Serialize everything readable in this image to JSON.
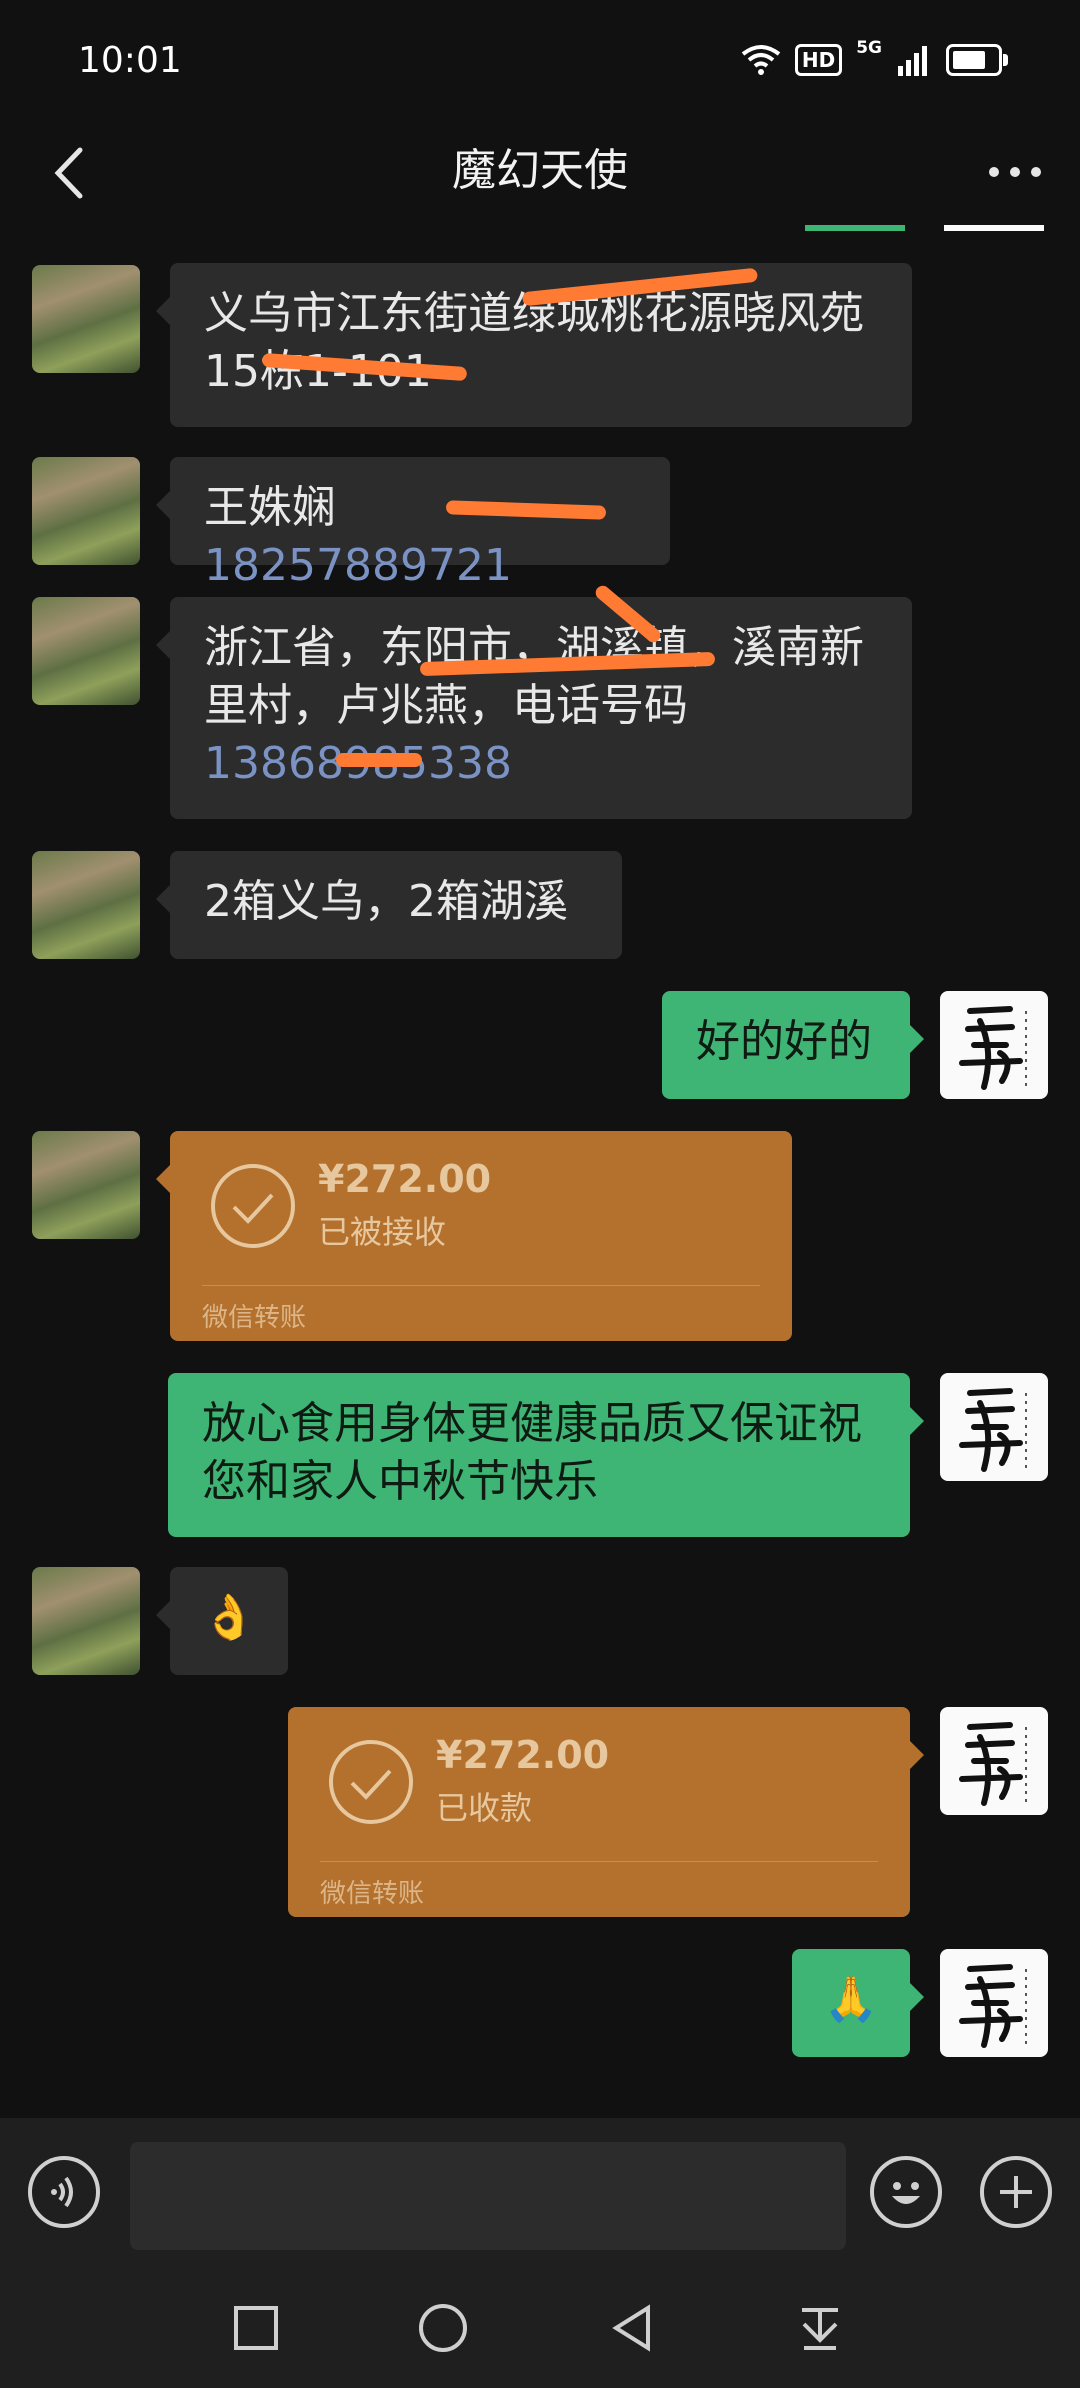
{
  "status_bar": {
    "time": "10:01",
    "hd": "HD",
    "network": "5G"
  },
  "header": {
    "title": "魔幻天使"
  },
  "messages": [
    {
      "side": "left",
      "text": "义乌市江东街道绿城桃花源晓风苑15栋1-101"
    },
    {
      "side": "left",
      "prefix": "王姝娴 ",
      "phone": "18257889721"
    },
    {
      "side": "left",
      "text": "浙江省，东阳市，湖溪镇，溪南新里村，卢兆燕，电话号码",
      "phone": "13868985338"
    },
    {
      "side": "left",
      "text": "2箱义乌，2箱湖溪"
    },
    {
      "side": "right",
      "text": "好的好的"
    },
    {
      "side": "left",
      "type": "transfer",
      "amount": "¥272.00",
      "status": "已被接收",
      "label": "微信转账"
    },
    {
      "side": "right",
      "text": "放心食用身体更健康品质又保证祝您和家人中秋节快乐"
    },
    {
      "side": "left",
      "emoji": "👌"
    },
    {
      "side": "right",
      "type": "transfer",
      "amount": "¥272.00",
      "status": "已收款",
      "label": "微信转账"
    },
    {
      "side": "right",
      "emoji": "🙏"
    }
  ],
  "colors": {
    "background": "#111111",
    "bubble_left": "#2c2c2c",
    "bubble_right": "#3eb575",
    "transfer": "#b3712d"
  },
  "icons": [
    "back-arrow-icon",
    "more-icon",
    "voice-icon",
    "emoji-icon",
    "plus-icon",
    "nav-square-icon",
    "nav-circle-icon",
    "nav-back-icon",
    "nav-collapse-icon"
  ]
}
